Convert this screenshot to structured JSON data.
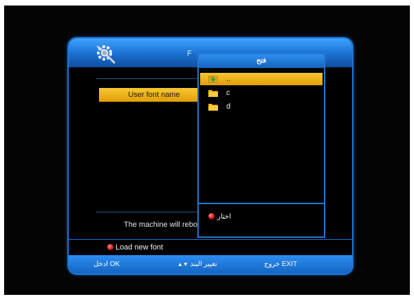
{
  "window": {
    "title_fragment": "F",
    "icon": "gear-icon"
  },
  "main": {
    "selected_item": "User font name",
    "reboot_message": "The machine will reboo"
  },
  "bottom_action": {
    "label": "Load new font",
    "key_color": "#e01010"
  },
  "footer": {
    "ok_label": "ادخل OK",
    "change_label": "تغيير البند",
    "exit_label": "خروج EXIT"
  },
  "dialog": {
    "title": "فتح",
    "items": [
      {
        "label": "..",
        "icon": "folder-up-icon",
        "selected": true
      },
      {
        "label": "c",
        "icon": "folder-icon",
        "selected": false
      },
      {
        "label": "d",
        "icon": "folder-icon",
        "selected": false
      }
    ],
    "choose_label": "اختار",
    "choose_key_color": "#e01010"
  },
  "colors": {
    "accent_blue": "#1b78d8",
    "highlight_yellow": "#f0b41a",
    "background": "#000000"
  }
}
